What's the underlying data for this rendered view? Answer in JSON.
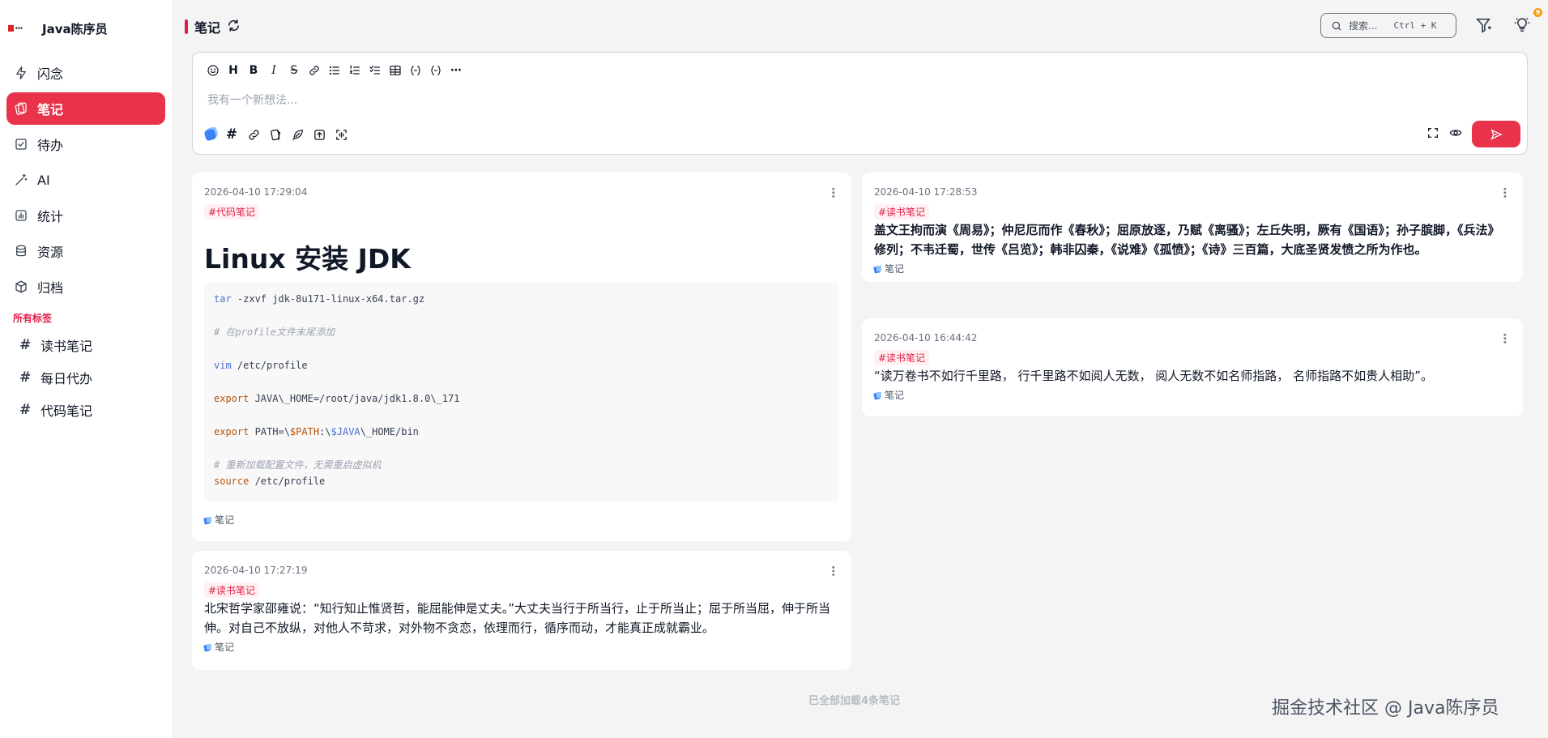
{
  "brand": {
    "name": "Java陈序员"
  },
  "nav": {
    "items": [
      {
        "label": "闪念",
        "icon": "lightning-icon"
      },
      {
        "label": "笔记",
        "icon": "notes-icon",
        "active": true
      },
      {
        "label": "待办",
        "icon": "todo-icon"
      },
      {
        "label": "AI",
        "icon": "magic-wand-icon"
      },
      {
        "label": "统计",
        "icon": "chart-icon"
      },
      {
        "label": "资源",
        "icon": "database-icon"
      },
      {
        "label": "归档",
        "icon": "box-icon"
      }
    ],
    "tags_heading": "所有标签",
    "tags": [
      {
        "label": "读书笔记"
      },
      {
        "label": "每日代办"
      },
      {
        "label": "代码笔记"
      }
    ]
  },
  "header": {
    "title": "笔记",
    "search": {
      "placeholder": "搜索...",
      "shortcut": "Ctrl + K"
    },
    "bulb_badge": "9"
  },
  "editor": {
    "placeholder": "我有一个新想法...",
    "toolbar_text": {
      "heading": "H",
      "bold": "B",
      "italic": "I",
      "strike": "S",
      "more": "⋯"
    },
    "hash_label": "#"
  },
  "cards": [
    {
      "time": "2026-04-10 17:29:04",
      "tag": "#代码笔记",
      "title": "Linux 安装 JDK",
      "code": {
        "l1_cmd": "tar",
        "l1_rest": " -zxvf jdk-8u171-linux-x64.tar.gz",
        "l2_comment": "# 在profile文件末尾添加",
        "l3_cmd": "vim",
        "l3_rest": " /etc/profile",
        "l4_cmd": "export",
        "l4_rest": " JAVA\\_HOME=/root/java/jdk1.8.0\\_171",
        "l5_cmd": "export",
        "l5_mid1": " PATH=\\",
        "l5_var1": "$PATH",
        "l5_mid2": ":\\",
        "l5_var2": "$JAVA",
        "l5_rest": "\\_HOME/bin",
        "l6_comment": "# 重新加载配置文件，无需重启虚拟机",
        "l7_cmd": "source",
        "l7_rest": " /etc/profile"
      },
      "footer": "笔记"
    },
    {
      "time": "2026-04-10 17:27:19",
      "tag": "#读书笔记",
      "text": "北宋哲学家邵雍说：“知行知止惟贤哲，能屈能伸是丈夫。”大丈夫当行于所当行，止于所当止；屈于所当屈，伸于所当伸。对自己不放纵，对他人不苛求，对外物不贪恋，依理而行，循序而动，才能真正成就霸业。",
      "footer": "笔记"
    },
    {
      "time": "2026-04-10 17:28:53",
      "tag": "#读书笔记",
      "text": "盖文王拘而演《周易》；仲尼厄而作《春秋》；屈原放逐，乃赋《离骚》；左丘失明，厥有《国语》；孙子膑脚，《兵法》修列；不韦迁蜀，世传《吕览》；韩非囚秦，《说难》《孤愤》；《诗》三百篇，大底圣贤发愤之所为作也。",
      "footer": "笔记"
    },
    {
      "time": "2026-04-10 16:44:42",
      "tag": "#读书笔记",
      "text": "“读万卷书不如行千里路， 行千里路不如阅人无数， 阅人无数不如名师指路， 名师指路不如贵人相助”。",
      "footer": "笔记"
    }
  ],
  "footer_message": "已全部加载4条笔记",
  "watermark": "掘金技术社区 @ Java陈序员",
  "colors": {
    "accent": "#e8334a",
    "tag": "#e11d48"
  }
}
